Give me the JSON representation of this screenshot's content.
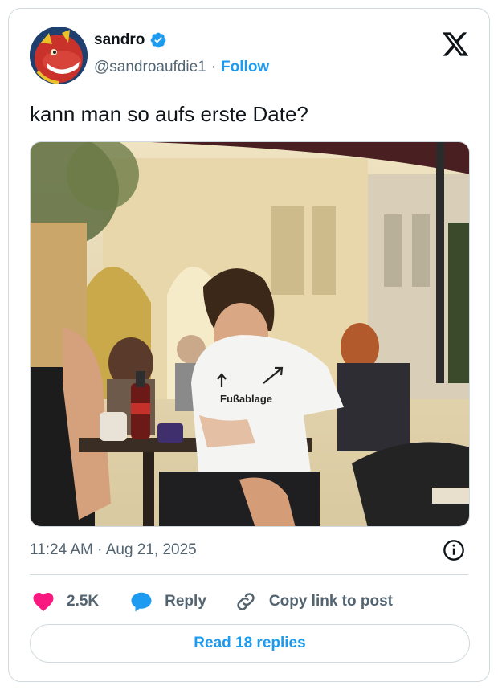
{
  "author": {
    "display_name": "sandro",
    "handle": "@sandroaufdie1",
    "separator": "·",
    "follow_label": "Follow",
    "verified": true
  },
  "tweet": {
    "text": "kann man so aufs erste Date?",
    "photo": {
      "shirt_text": "Fußablage",
      "description_icons": [
        "arrow-up-icon",
        "arrow-up-right-icon"
      ]
    },
    "timestamp": "11:24 AM · Aug 21, 2025"
  },
  "actions": {
    "like_count": "2.5K",
    "reply_label": "Reply",
    "copy_label": "Copy link to post"
  },
  "footer": {
    "read_replies_label": "Read 18 replies"
  },
  "colors": {
    "accent": "#1d9bf0",
    "like": "#f91880",
    "text": "#0f1419",
    "muted": "#536471",
    "border": "#cfd9de"
  }
}
